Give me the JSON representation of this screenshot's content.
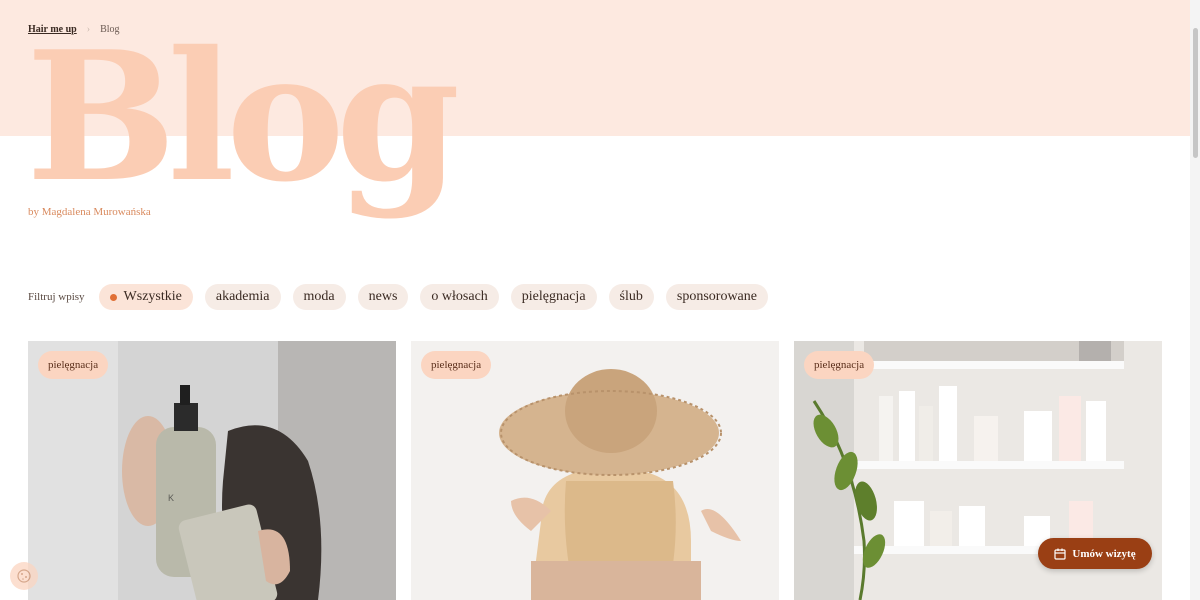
{
  "breadcrumb": {
    "home": "Hair me up",
    "current": "Blog"
  },
  "hero": {
    "title": "Blog",
    "author": "by Magdalena Murowańska"
  },
  "filters": {
    "label": "Filtruj wpisy",
    "items": [
      "Wszystkie",
      "akademia",
      "moda",
      "news",
      "o włosach",
      "pielęgnacja",
      "ślub",
      "sponsorowane"
    ],
    "active": "Wszystkie"
  },
  "cards": [
    {
      "tag": "pielęgnacja",
      "image": "kevin-murphy-bottles-photo"
    },
    {
      "tag": "pielęgnacja",
      "image": "woman-straw-hat-photo"
    },
    {
      "tag": "pielęgnacja",
      "image": "salon-product-shelves-photo"
    }
  ],
  "cta": {
    "label": "Umów wizytę",
    "icon": "calendar-icon"
  },
  "cookie": {
    "icon": "cookie-icon"
  },
  "colors": {
    "hero_band": "#fde9e0",
    "hero_title": "#fbcdb4",
    "accent": "#e06f35",
    "cta": "#9a3f14",
    "tag": "#fbd5c1"
  }
}
